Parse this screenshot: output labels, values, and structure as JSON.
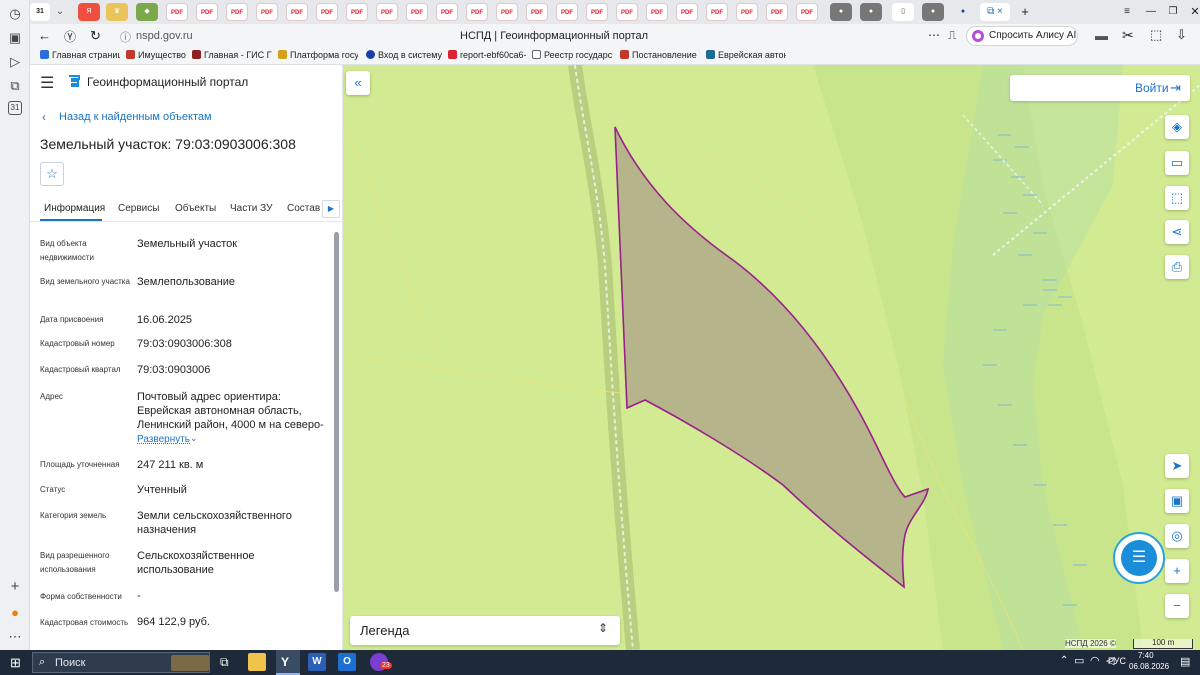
{
  "browser": {
    "tab_active_label": "31",
    "url": "nspd.gov.ru",
    "page_title": "НСПД | Геоинформационный портал",
    "alice_label": "Спросить Алису AI",
    "pdf_label": "PDF",
    "bookmarks": [
      "Главная страница",
      "Имущество",
      "Главная - ГИС ГМП",
      "Платформа госуд",
      "Вход в систему",
      "report-ebf60ca6-4",
      "Реестр государст",
      "Постановление П",
      "Еврейская автоно"
    ]
  },
  "portal": {
    "title": "Геоинформационный портал",
    "back_label": "Назад к найденным объектам",
    "object_title": "Земельный участок: 79:03:0903006:308"
  },
  "tabs": [
    "Информация",
    "Сервисы",
    "Объекты",
    "Части ЗУ",
    "Состав"
  ],
  "info": [
    {
      "label": "Вид объекта недвижимости",
      "value": "Земельный участок"
    },
    {
      "label": "Вид земельного участка",
      "value": "Землепользование"
    },
    {
      "label": "Дата присвоения",
      "value": "16.06.2025"
    },
    {
      "label": "Кадастровый номер",
      "value": "79:03:0903006:308"
    },
    {
      "label": "Кадастровый квартал",
      "value": "79:03:0903006"
    },
    {
      "label": "Адрес",
      "value": "Почтовый адрес ориентира: Еврейская автономная область, Ленинский район, 4000 м на северо-"
    },
    {
      "label": "Площадь уточненная",
      "value": "247 211 кв. м"
    },
    {
      "label": "Статус",
      "value": "Учтенный"
    },
    {
      "label": "Категория земель",
      "value": "Земли сельскохозяйственного назначения"
    },
    {
      "label": "Вид разрешенного использования",
      "value": "Сельскохозяйственное использование"
    },
    {
      "label": "Форма собственности",
      "value": "-"
    },
    {
      "label": "Кадастровая стоимость",
      "value": "964 122,9 руб."
    }
  ],
  "expand_label": "Развернуть",
  "map": {
    "login_label": "Войти",
    "legend_label": "Легенда",
    "copyright": "НСПД 2026 ©",
    "scale_label": "100 m",
    "parcel_fill": "#b5b48a",
    "parcel_stroke": "#9a1f8c"
  },
  "taskbar": {
    "search_label": "Поиск",
    "lang": "РУС",
    "time": "7:40",
    "date": "06.08.2026",
    "mail_badge": "23"
  }
}
